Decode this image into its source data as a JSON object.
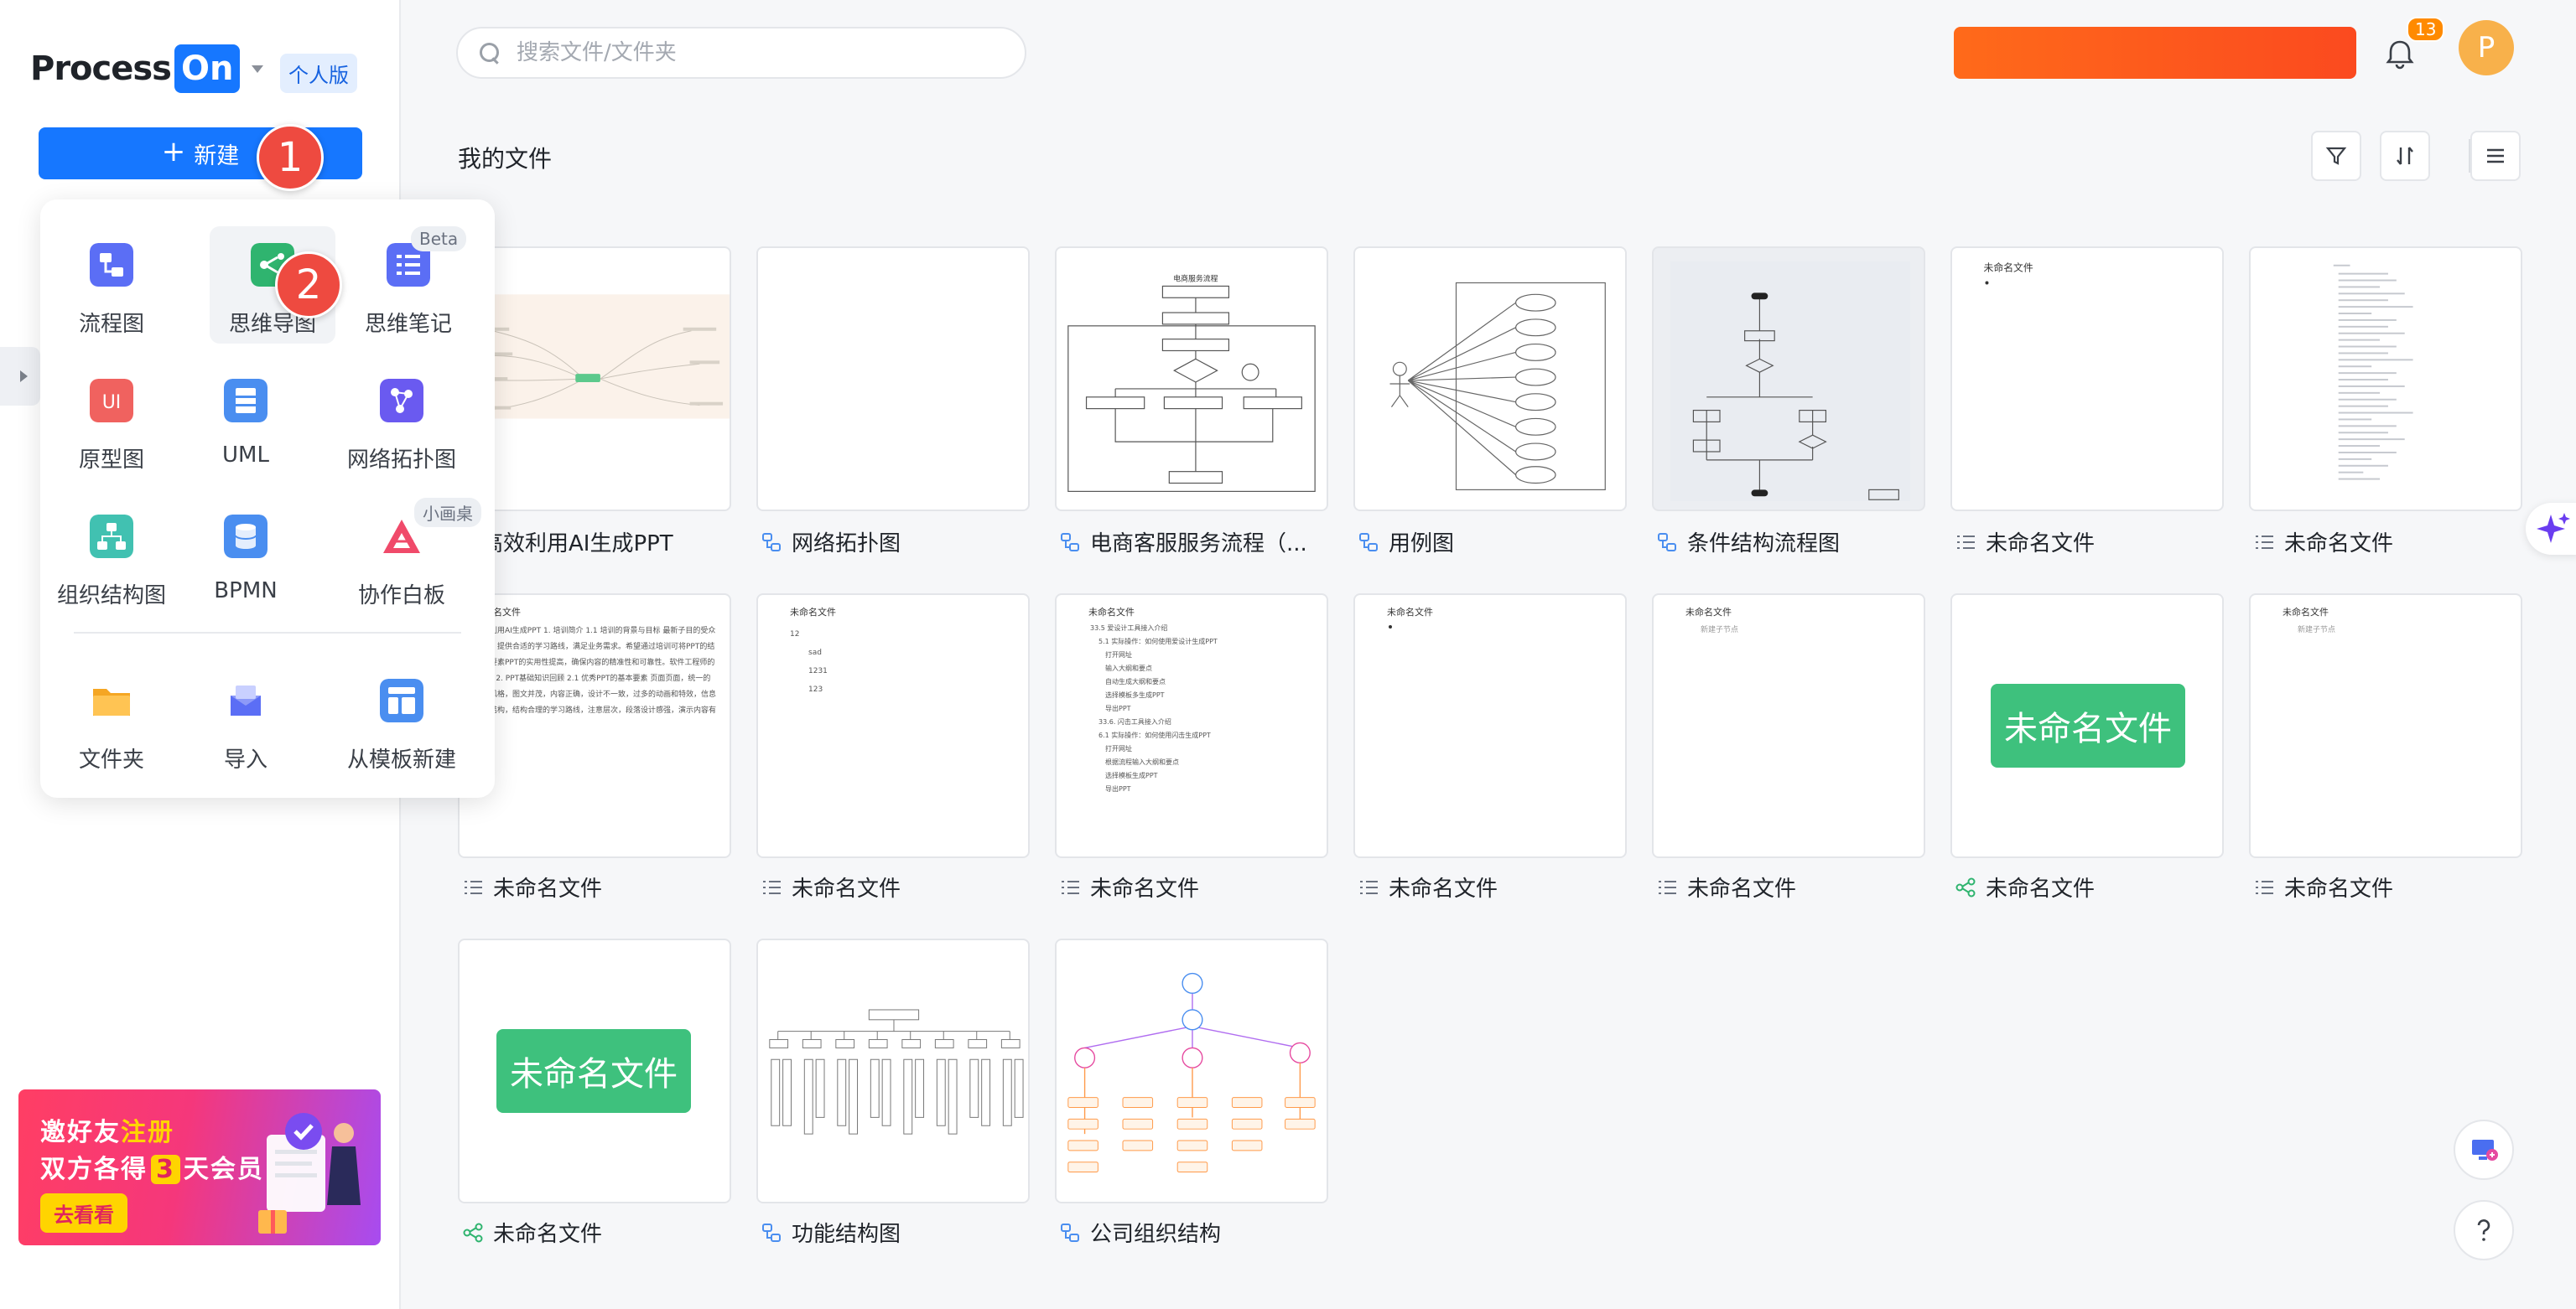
{
  "app": {
    "logo_process": "Process",
    "logo_on": "On",
    "plan_badge": "个人版"
  },
  "sidebar": {
    "new_button_label": "新建",
    "step_markers": [
      "1",
      "2"
    ],
    "promo": {
      "line1_prefix": "邀好友",
      "line1_highlight": "注册",
      "line2_prefix": "双方各得",
      "line2_number": "3",
      "line2_suffix": "天会员",
      "cta": "去看看"
    }
  },
  "create_menu": {
    "items": [
      {
        "label": "流程图",
        "icon": "flowchart-icon",
        "color": "#5b6ef5"
      },
      {
        "label": "思维导图",
        "icon": "mindmap-icon",
        "color": "#2fb46f"
      },
      {
        "label": "思维笔记",
        "icon": "mindnote-icon",
        "color": "#5b6ef5",
        "tag": "Beta"
      },
      {
        "label": "原型图",
        "icon": "prototype-icon",
        "color": "#f0625f"
      },
      {
        "label": "UML",
        "icon": "uml-icon",
        "color": "#4a8ef0"
      },
      {
        "label": "网络拓扑图",
        "icon": "network-icon",
        "color": "#6a5af0"
      },
      {
        "label": "组织结构图",
        "icon": "org-chart-icon",
        "color": "#41c1b1"
      },
      {
        "label": "BPMN",
        "icon": "bpmn-icon",
        "color": "#4a8ef0"
      },
      {
        "label": "协作白板",
        "icon": "whiteboard-icon",
        "color": "#f04a6a",
        "tag": "小画桌"
      },
      {
        "label": "文件夹",
        "icon": "folder-icon",
        "color": "#f5a623"
      },
      {
        "label": "导入",
        "icon": "import-icon",
        "color": "#5b6ef5"
      },
      {
        "label": "从模板新建",
        "icon": "template-icon",
        "color": "#4a8ef0"
      }
    ]
  },
  "topbar": {
    "search_placeholder": "搜索文件/文件夹",
    "notification_count": "13",
    "avatar_initial": "P"
  },
  "main": {
    "title": "我的文件",
    "files": [
      {
        "name": "高效利用AI生成PPT",
        "type": "mindmap"
      },
      {
        "name": "网络拓扑图",
        "type": "flow"
      },
      {
        "name": "电商客服服务流程（...",
        "type": "flow"
      },
      {
        "name": "用例图",
        "type": "flow"
      },
      {
        "name": "条件结构流程图",
        "type": "flow"
      },
      {
        "name": "未命名文件",
        "type": "note"
      },
      {
        "name": "未命名文件",
        "type": "note"
      },
      {
        "name": "未命名文件",
        "type": "note"
      },
      {
        "name": "未命名文件",
        "type": "note"
      },
      {
        "name": "未命名文件",
        "type": "note"
      },
      {
        "name": "未命名文件",
        "type": "note"
      },
      {
        "name": "未命名文件",
        "type": "note"
      },
      {
        "name": "未命名文件",
        "type": "mindmap"
      },
      {
        "name": "未命名文件",
        "type": "note"
      },
      {
        "name": "未命名文件",
        "type": "mindmap"
      },
      {
        "name": "功能结构图",
        "type": "flow"
      },
      {
        "name": "公司组织结构",
        "type": "flow"
      }
    ],
    "preview_texts": {
      "note_title": "未命名文件",
      "note_sub": "新建子节点",
      "green_label": "未命名文件",
      "note_items_a": [
        "12",
        "sad",
        "1231",
        "123"
      ],
      "note_items_b": [
        "33.5 爱设计工具接入介绍",
        "5.1 实际操作：如何使用爱设计生成PPT",
        "打开网址",
        "输入大纲和要点",
        "自动生成大纲和要点",
        "选择模板多生成PPT",
        "导出PPT",
        "33.6. 闪击工具接入介绍",
        "6.1 实际操作：如何使用闪击生成PPT",
        "打开网址",
        "根据流程输入大纲和要点",
        "选择模板生成PPT",
        "导出PPT"
      ],
      "doc_paragraph": "高效利用AI生成PPT 1. 培训简介 1.1 培训的背景与目标 最新子目的受众人群，提供合适的学习路线，满足业务需求。希望通过培训可将PPT的结构和要素PPT的实用性提高，确保内容的精准性和可靠性。软件工程师的PPT，2. PPT基础知识回顾 2.1 优秀PPT的基本要素 页面页面，统一的设计风格，图文并茂，内容正确，设计不一致，过多的动画和特效，信息层次结构，结构合理的学习路线，注意层次，段落设计感强，演示内容有序。",
      "flow_title": "电商服务流程"
    }
  }
}
